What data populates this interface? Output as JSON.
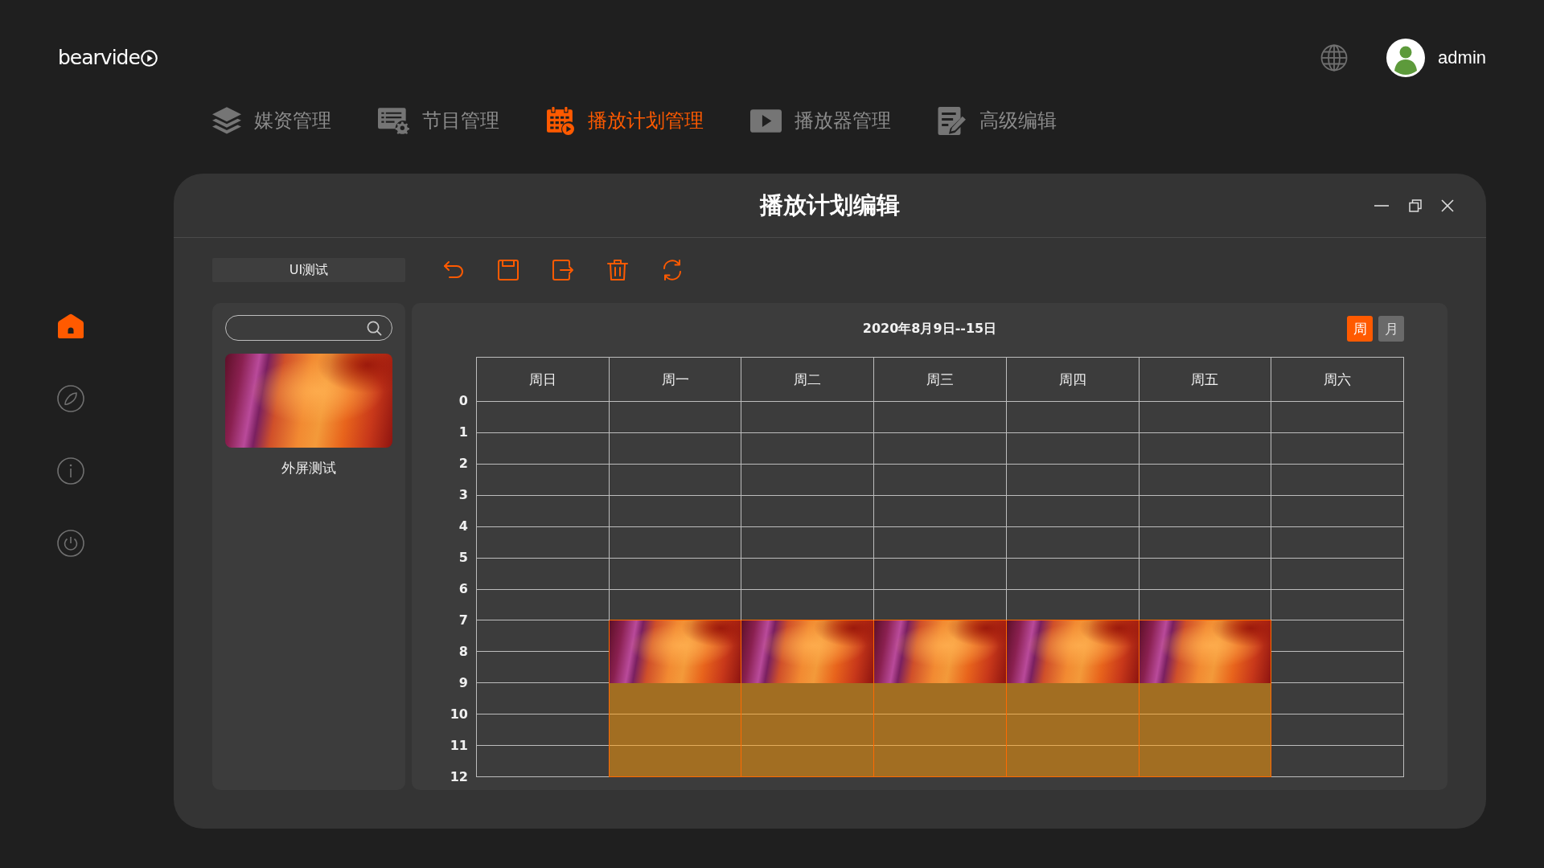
{
  "logo": {
    "text": "bearvide"
  },
  "header": {
    "username": "admin"
  },
  "nav": [
    {
      "label": "媒资管理",
      "kind": "layers",
      "selected": false
    },
    {
      "label": "节目管理",
      "kind": "program",
      "selected": false
    },
    {
      "label": "播放计划管理",
      "kind": "calendar",
      "selected": true
    },
    {
      "label": "播放器管理",
      "kind": "player",
      "selected": false
    },
    {
      "label": "高级编辑",
      "kind": "editor",
      "selected": false
    }
  ],
  "sidebar": [
    {
      "kind": "home",
      "selected": true
    },
    {
      "kind": "compass",
      "selected": false
    },
    {
      "kind": "info",
      "selected": false
    },
    {
      "kind": "power",
      "selected": false
    }
  ],
  "window": {
    "title": "播放计划编辑"
  },
  "toolbar": {
    "plan_name": "UI测试",
    "actions": [
      {
        "kind": "undo"
      },
      {
        "kind": "save"
      },
      {
        "kind": "export"
      },
      {
        "kind": "delete"
      },
      {
        "kind": "refresh"
      }
    ]
  },
  "media_list": [
    {
      "title": "外屏测试"
    }
  ],
  "calendar": {
    "range": "2020年8月9日--15日",
    "views": [
      {
        "label": "周",
        "selected": true
      },
      {
        "label": "月",
        "selected": false
      }
    ],
    "hours": [
      "0",
      "1",
      "2",
      "3",
      "4",
      "5",
      "6",
      "7",
      "8",
      "9",
      "10",
      "11",
      "12"
    ],
    "days": [
      {
        "label": "周日",
        "slots": [
          {
            "kind": "empty"
          },
          {
            "kind": "empty"
          },
          {
            "kind": "empty"
          },
          {
            "kind": "empty"
          },
          {
            "kind": "empty"
          },
          {
            "kind": "empty"
          },
          {
            "kind": "empty"
          },
          {
            "kind": "empty"
          },
          {
            "kind": "empty"
          },
          {
            "kind": "empty"
          },
          {
            "kind": "empty"
          },
          {
            "kind": "empty"
          }
        ]
      },
      {
        "label": "周一",
        "slots": [
          {
            "kind": "empty"
          },
          {
            "kind": "empty"
          },
          {
            "kind": "empty"
          },
          {
            "kind": "empty"
          },
          {
            "kind": "empty"
          },
          {
            "kind": "empty"
          },
          {
            "kind": "empty"
          },
          {
            "kind": "media"
          },
          {
            "kind": "media"
          },
          {
            "kind": "fill"
          },
          {
            "kind": "fill"
          },
          {
            "kind": "fill"
          }
        ]
      },
      {
        "label": "周二",
        "slots": [
          {
            "kind": "empty"
          },
          {
            "kind": "empty"
          },
          {
            "kind": "empty"
          },
          {
            "kind": "empty"
          },
          {
            "kind": "empty"
          },
          {
            "kind": "empty"
          },
          {
            "kind": "empty"
          },
          {
            "kind": "media"
          },
          {
            "kind": "media"
          },
          {
            "kind": "fill"
          },
          {
            "kind": "fill"
          },
          {
            "kind": "fill"
          }
        ]
      },
      {
        "label": "周三",
        "slots": [
          {
            "kind": "empty"
          },
          {
            "kind": "empty"
          },
          {
            "kind": "empty"
          },
          {
            "kind": "empty"
          },
          {
            "kind": "empty"
          },
          {
            "kind": "empty"
          },
          {
            "kind": "empty"
          },
          {
            "kind": "media"
          },
          {
            "kind": "media"
          },
          {
            "kind": "fill"
          },
          {
            "kind": "fill"
          },
          {
            "kind": "fill"
          }
        ]
      },
      {
        "label": "周四",
        "slots": [
          {
            "kind": "empty"
          },
          {
            "kind": "empty"
          },
          {
            "kind": "empty"
          },
          {
            "kind": "empty"
          },
          {
            "kind": "empty"
          },
          {
            "kind": "empty"
          },
          {
            "kind": "empty"
          },
          {
            "kind": "media"
          },
          {
            "kind": "media"
          },
          {
            "kind": "fill"
          },
          {
            "kind": "fill"
          },
          {
            "kind": "fill"
          }
        ]
      },
      {
        "label": "周五",
        "slots": [
          {
            "kind": "empty"
          },
          {
            "kind": "empty"
          },
          {
            "kind": "empty"
          },
          {
            "kind": "empty"
          },
          {
            "kind": "empty"
          },
          {
            "kind": "empty"
          },
          {
            "kind": "empty"
          },
          {
            "kind": "media"
          },
          {
            "kind": "media"
          },
          {
            "kind": "fill"
          },
          {
            "kind": "fill"
          },
          {
            "kind": "fill"
          }
        ]
      },
      {
        "label": "周六",
        "slots": [
          {
            "kind": "empty"
          },
          {
            "kind": "empty"
          },
          {
            "kind": "empty"
          },
          {
            "kind": "empty"
          },
          {
            "kind": "empty"
          },
          {
            "kind": "empty"
          },
          {
            "kind": "empty"
          },
          {
            "kind": "empty"
          },
          {
            "kind": "empty"
          },
          {
            "kind": "empty"
          },
          {
            "kind": "empty"
          },
          {
            "kind": "empty"
          }
        ]
      }
    ]
  }
}
